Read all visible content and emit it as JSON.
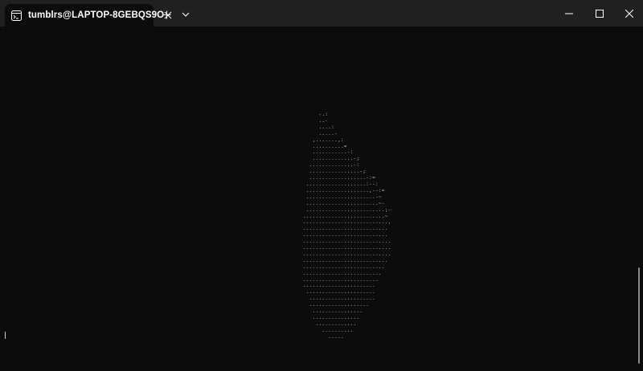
{
  "window": {
    "tab_title": "tumblrs@LAPTOP-8GEBQS9O",
    "icons": {
      "tab": "terminal-icon",
      "tab_close": "close-icon",
      "new_tab": "plus-icon",
      "dropdown": "chevron-down-icon",
      "minimize": "minimize-icon",
      "maximize": "maximize-icon",
      "close": "close-icon"
    }
  },
  "terminal": {
    "ascii_art": "     -.:\n     ..-\n     ....:\n     .....-\n   ,.......,:\n   ..........=\n   ...........-:\n   .............-;\n  ..............-:\n  ................-;\n  ..................-:=\n ...................:--:\n ....................,--:=\n ......................-~\n .......................~-\n .........................;-\n..........................~\n...........................,\n...........................\n...........................\n............................\n............................\n............................\n...........................\n..........................\n.........................\n........................\n.......................\n ......................\n  .....................\n  ...................\n   ................\n   ...............\n    .............\n      ..........\n        .....",
    "colors": {
      "background": "#0c0c0c",
      "titlebar": "#202020",
      "text": "#bdbdbd"
    }
  }
}
